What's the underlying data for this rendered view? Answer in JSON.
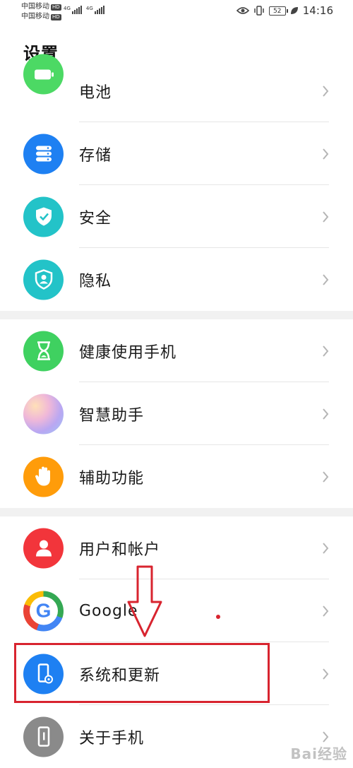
{
  "status_bar": {
    "carrier_1": "中国移动",
    "carrier_2": "中国移动",
    "hd": "HD",
    "net_1": "4G",
    "net_2": "4G",
    "battery": "52",
    "time": "14:16"
  },
  "page": {
    "title": "设置"
  },
  "items": [
    {
      "label": "电池",
      "icon": "battery-icon",
      "color": "#4cd964"
    },
    {
      "label": "存储",
      "icon": "storage-icon",
      "color": "#1e80f2"
    },
    {
      "label": "安全",
      "icon": "shield-icon",
      "color": "#23c3c8"
    },
    {
      "label": "隐私",
      "icon": "privacy-icon",
      "color": "#23c3c8"
    },
    {
      "label": "健康使用手机",
      "icon": "hourglass-icon",
      "color": "#3fd160"
    },
    {
      "label": "智慧助手",
      "icon": "assistant-icon",
      "color": "#c9b3f0"
    },
    {
      "label": "辅助功能",
      "icon": "hand-icon",
      "color": "#ff9c0a"
    },
    {
      "label": "用户和帐户",
      "icon": "user-icon",
      "color": "#f2353b"
    },
    {
      "label": "Google",
      "icon": "google-icon",
      "color": "#ffffff"
    },
    {
      "label": "系统和更新",
      "icon": "system-update-icon",
      "color": "#1e80f2"
    },
    {
      "label": "关于手机",
      "icon": "phone-info-icon",
      "color": "#8a8a8a"
    }
  ],
  "watermark": "Bai经验"
}
